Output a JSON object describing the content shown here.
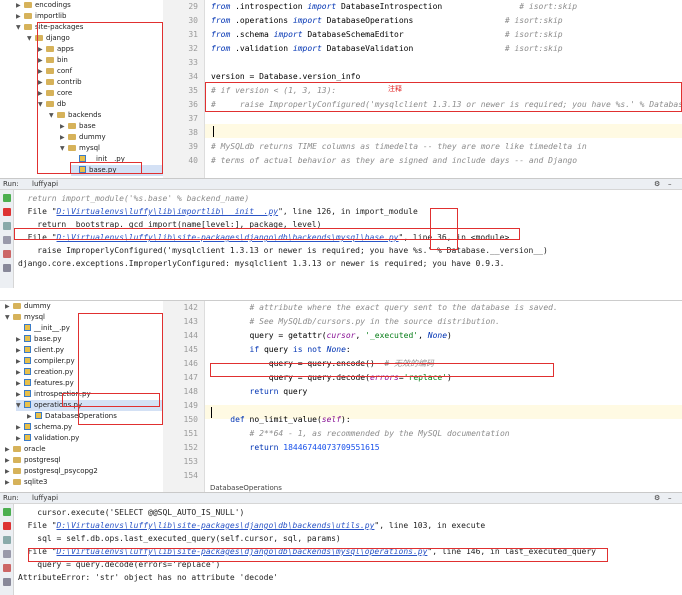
{
  "top": {
    "tree": [
      {
        "label": "encodings",
        "indent": 2,
        "type": "folder",
        "arrow": "▶"
      },
      {
        "label": "importlib",
        "indent": 2,
        "type": "folder",
        "arrow": "▶"
      },
      {
        "label": "site-packages",
        "indent": 2,
        "type": "folder",
        "arrow": "▼"
      },
      {
        "label": "django",
        "indent": 3,
        "type": "folder",
        "arrow": "▼"
      },
      {
        "label": "apps",
        "indent": 4,
        "type": "folder",
        "arrow": "▶"
      },
      {
        "label": "bin",
        "indent": 4,
        "type": "folder",
        "arrow": "▶"
      },
      {
        "label": "conf",
        "indent": 4,
        "type": "folder",
        "arrow": "▶"
      },
      {
        "label": "contrib",
        "indent": 4,
        "type": "folder",
        "arrow": "▶"
      },
      {
        "label": "core",
        "indent": 4,
        "type": "folder",
        "arrow": "▶"
      },
      {
        "label": "db",
        "indent": 4,
        "type": "folder",
        "arrow": "▼"
      },
      {
        "label": "backends",
        "indent": 5,
        "type": "folder",
        "arrow": "▼"
      },
      {
        "label": "base",
        "indent": 6,
        "type": "folder",
        "arrow": "▶"
      },
      {
        "label": "dummy",
        "indent": 6,
        "type": "folder",
        "arrow": "▶"
      },
      {
        "label": "mysql",
        "indent": 6,
        "type": "folder",
        "arrow": "▼"
      },
      {
        "label": "__init__.py",
        "indent": 7,
        "type": "file",
        "arrow": ""
      },
      {
        "label": "base.py",
        "indent": 7,
        "type": "file",
        "arrow": "",
        "selected": true
      }
    ],
    "lines": [
      {
        "n": "29",
        "html": "<span class='kw'>from</span> .introspection <span class='kw'>import</span> DatabaseIntrospection                <span class='cm'># isort:skip</span>"
      },
      {
        "n": "30",
        "html": "<span class='kw'>from</span> .operations <span class='kw'>import</span> DatabaseOperations                   <span class='cm'># isort:skip</span>"
      },
      {
        "n": "31",
        "html": "<span class='kw'>from</span> .schema <span class='kw'>import</span> DatabaseSchemaEditor                     <span class='cm'># isort:skip</span>"
      },
      {
        "n": "32",
        "html": "<span class='kw'>from</span> .validation <span class='kw'>import</span> DatabaseValidation                   <span class='cm'># isort:skip</span>"
      },
      {
        "n": "33",
        "html": ""
      },
      {
        "n": "34",
        "html": "version = Database.version_info"
      },
      {
        "n": "35",
        "html": "<span class='cm'># if version &lt; (1, 3, 13):</span>"
      },
      {
        "n": "36",
        "html": "<span class='cm'>#     raise ImproperlyConfigured('mysqlclient 1.3.13 or newer is required; you have %s.' % Database.__version__)</span>"
      },
      {
        "n": "37",
        "html": ""
      },
      {
        "n": "38",
        "html": ""
      },
      {
        "n": "39",
        "html": "<span class='cm'># MySQLdb returns TIME columns as timedelta -- they are more like timedelta in</span>"
      },
      {
        "n": "40",
        "html": "<span class='cm'># terms of actual behavior as they are signed and include days -- and Django</span>"
      }
    ],
    "annotation": "注释"
  },
  "run1": {
    "label": "Run:",
    "tab": "luffyapi",
    "lines": [
      {
        "html": "  <span class='cm'>return import_module('%s.base' % backend_name)</span>"
      },
      {
        "html": "  File \"<span class='link'>D:\\Virtualenvs\\luffy\\lib\\importlib\\__init__.py</span>\", line 126, in import_module"
      },
      {
        "html": "    return _bootstrap._gcd_import(name[level:], package, level)"
      },
      {
        "html": "  File \"<span class='link'>D:\\Virtualenvs\\luffy\\lib\\site-packages\\django\\db\\backends\\mysql\\base.py</span>\", line 36, in &lt;module&gt;"
      },
      {
        "html": "    raise ImproperlyConfigured('mysqlclient 1.3.13 or newer is required; you have %s.' % Database.__version__)"
      },
      {
        "html": "django.core.exceptions.ImproperlyConfigured: mysqlclient 1.3.13 or newer is required; you have 0.9.3."
      }
    ]
  },
  "bottom": {
    "tree": [
      {
        "label": "dummy",
        "indent": 1,
        "type": "folder",
        "arrow": "▶"
      },
      {
        "label": "mysql",
        "indent": 1,
        "type": "folder",
        "arrow": "▼"
      },
      {
        "label": "__init__.py",
        "indent": 2,
        "type": "file",
        "arrow": ""
      },
      {
        "label": "base.py",
        "indent": 2,
        "type": "file",
        "arrow": "▶"
      },
      {
        "label": "client.py",
        "indent": 2,
        "type": "file",
        "arrow": "▶"
      },
      {
        "label": "compiler.py",
        "indent": 2,
        "type": "file",
        "arrow": "▶"
      },
      {
        "label": "creation.py",
        "indent": 2,
        "type": "file",
        "arrow": "▶"
      },
      {
        "label": "features.py",
        "indent": 2,
        "type": "file",
        "arrow": "▶"
      },
      {
        "label": "introspection.py",
        "indent": 2,
        "type": "file",
        "arrow": "▶"
      },
      {
        "label": "operations.py",
        "indent": 2,
        "type": "file",
        "arrow": "▼",
        "selected": true
      },
      {
        "label": "DatabaseOperations",
        "indent": 3,
        "type": "file",
        "arrow": "▶"
      },
      {
        "label": "schema.py",
        "indent": 2,
        "type": "file",
        "arrow": "▶"
      },
      {
        "label": "validation.py",
        "indent": 2,
        "type": "file",
        "arrow": "▶"
      },
      {
        "label": "oracle",
        "indent": 1,
        "type": "folder",
        "arrow": "▶"
      },
      {
        "label": "postgresql",
        "indent": 1,
        "type": "folder",
        "arrow": "▶"
      },
      {
        "label": "postgresql_psycopg2",
        "indent": 1,
        "type": "folder",
        "arrow": "▶"
      },
      {
        "label": "sqlite3",
        "indent": 1,
        "type": "folder",
        "arrow": "▶"
      }
    ],
    "lines": [
      {
        "n": "142",
        "html": "        <span class='cm'># attribute where the exact query sent to the database is saved.</span>"
      },
      {
        "n": "143",
        "html": "        <span class='cm'># See MySQLdb/cursors.py in the source distribution.</span>"
      },
      {
        "n": "144",
        "html": "        query = getattr(<span class='par'>cursor</span>, <span class='str'>'_executed'</span>, <span class='kw'>None</span>)"
      },
      {
        "n": "145",
        "html": "        <span class='kwb'>if</span> query <span class='kwb'>is not</span> <span class='kw'>None</span>:"
      },
      {
        "n": "146",
        "html": "            query = query.encode()  <span class='cm'># 无效的编码</span>"
      },
      {
        "n": "147",
        "html": "            query = query.decode(<span class='par'>errors</span>=<span class='str'>'replace'</span>)"
      },
      {
        "n": "148",
        "html": "        <span class='kwb'>return</span> query"
      },
      {
        "n": "149",
        "html": ""
      },
      {
        "n": "150",
        "html": "    <span class='kwb'>def</span> no_limit_value(<span class='par'>self</span>):"
      },
      {
        "n": "151",
        "html": "        <span class='cm'># 2**64 - 1, as recommended by the MySQL documentation</span>"
      },
      {
        "n": "152",
        "html": "        <span class='kwb'>return</span> <span class='num'>18446744073709551615</span>"
      },
      {
        "n": "153",
        "html": ""
      },
      {
        "n": "154",
        "html": ""
      }
    ],
    "breadcrumb": "DatabaseOperations"
  },
  "run2": {
    "label": "Run:",
    "tab": "luffyapi",
    "lines": [
      {
        "html": "    cursor.execute('SELECT @@SQL_AUTO_IS_NULL')"
      },
      {
        "html": "  File \"<span class='link'>D:\\Virtualenvs\\luffy\\lib\\site-packages\\django\\db\\backends\\utils.py</span>\", line 103, in execute"
      },
      {
        "html": "    sql = self.db.ops.last_executed_query(self.cursor, sql, params)"
      },
      {
        "html": "  File \"<span class='link'>D:\\Virtualenvs\\luffy\\lib\\site-packages\\django\\db\\backends\\mysql\\operations.py</span>\", line 146, in last_executed_query"
      },
      {
        "html": "    query = query.decode(errors='replace')"
      },
      {
        "html": "AttributeError: 'str' object has no attribute 'decode'"
      }
    ]
  }
}
